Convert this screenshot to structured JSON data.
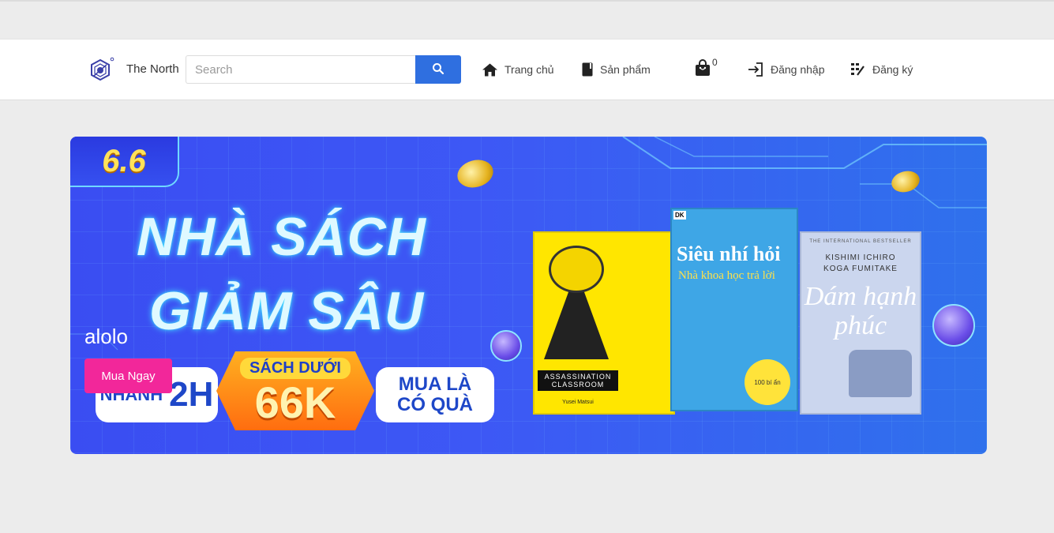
{
  "brand": {
    "name": "The North"
  },
  "search": {
    "placeholder": "Search",
    "value": ""
  },
  "nav": {
    "home": "Trang chủ",
    "products": "Sản phẩm",
    "cart_count": "0",
    "login": "Đăng nhập",
    "register": "Đăng ký"
  },
  "icons": {
    "logo": "the-north-logo-icon",
    "search": "search-icon",
    "home": "home-icon",
    "products": "book-icon",
    "cart": "shopping-bag-icon",
    "login": "login-icon",
    "register": "register-icon"
  },
  "banner": {
    "badge": "6.6",
    "headline_line1": "NHÀ SÁCH",
    "headline_line2": "GIẢM SÂU",
    "pill_left_small": "NHANH",
    "pill_left_big": "2H",
    "sale_label": "SÁCH DƯỚI",
    "sale_price": "66K",
    "pill_right_line1": "MUA LÀ",
    "pill_right_line2": "CÓ QUÀ",
    "book1_title": "ASSASSINATION CLASSROOM",
    "book1_author": "Yusei Matsui",
    "book2_publisher": "DK",
    "book2_title": "Siêu nhí hỏi",
    "book2_subtitle": "Nhà khoa học trả lời",
    "book2_sticker": "100 bí ẩn",
    "book3_tagline": "THE INTERNATIONAL BESTSELLER",
    "book3_author1": "KISHIMI ICHIRO",
    "book3_author2": "KOGA FUMITAKE",
    "book3_title": "Dám hạnh phúc"
  },
  "hero": {
    "caption": "alolo",
    "cta": "Mua Ngay"
  },
  "colors": {
    "primary": "#2f6fe0",
    "cta": "#f2279a",
    "page_bg": "#ececec"
  }
}
